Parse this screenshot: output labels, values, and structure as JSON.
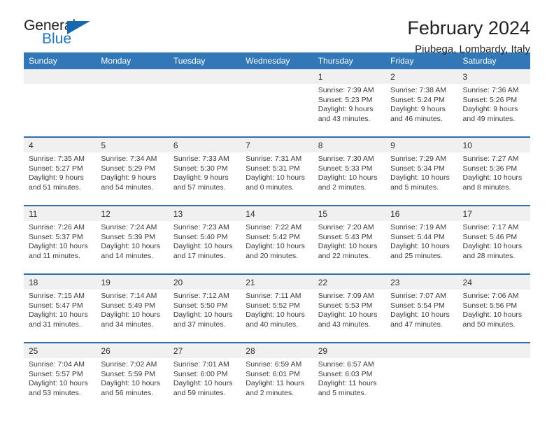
{
  "brand": {
    "name_top": "General",
    "name_bottom": "Blue",
    "triangle_icon": "triangle-icon",
    "colors": {
      "dark": "#222222",
      "blue": "#1a73c4",
      "triangle": "#1569b0"
    }
  },
  "header": {
    "title": "February 2024",
    "subtitle": "Piubega, Lombardy, Italy"
  },
  "colors": {
    "header_bar": "#3277b8",
    "date_band": "#f0f0f0",
    "row_divider": "#2f6fae",
    "text": "#3a3a3a"
  },
  "weekdays": [
    "Sunday",
    "Monday",
    "Tuesday",
    "Wednesday",
    "Thursday",
    "Friday",
    "Saturday"
  ],
  "weeks": [
    {
      "numbers": [
        "",
        "",
        "",
        "",
        "1",
        "2",
        "3"
      ],
      "cells": [
        {
          "sunrise": "",
          "sunset": "",
          "daylight_1": "",
          "daylight_2": ""
        },
        {
          "sunrise": "",
          "sunset": "",
          "daylight_1": "",
          "daylight_2": ""
        },
        {
          "sunrise": "",
          "sunset": "",
          "daylight_1": "",
          "daylight_2": ""
        },
        {
          "sunrise": "",
          "sunset": "",
          "daylight_1": "",
          "daylight_2": ""
        },
        {
          "sunrise": "Sunrise: 7:39 AM",
          "sunset": "Sunset: 5:23 PM",
          "daylight_1": "Daylight: 9 hours",
          "daylight_2": "and 43 minutes."
        },
        {
          "sunrise": "Sunrise: 7:38 AM",
          "sunset": "Sunset: 5:24 PM",
          "daylight_1": "Daylight: 9 hours",
          "daylight_2": "and 46 minutes."
        },
        {
          "sunrise": "Sunrise: 7:36 AM",
          "sunset": "Sunset: 5:26 PM",
          "daylight_1": "Daylight: 9 hours",
          "daylight_2": "and 49 minutes."
        }
      ]
    },
    {
      "numbers": [
        "4",
        "5",
        "6",
        "7",
        "8",
        "9",
        "10"
      ],
      "cells": [
        {
          "sunrise": "Sunrise: 7:35 AM",
          "sunset": "Sunset: 5:27 PM",
          "daylight_1": "Daylight: 9 hours",
          "daylight_2": "and 51 minutes."
        },
        {
          "sunrise": "Sunrise: 7:34 AM",
          "sunset": "Sunset: 5:29 PM",
          "daylight_1": "Daylight: 9 hours",
          "daylight_2": "and 54 minutes."
        },
        {
          "sunrise": "Sunrise: 7:33 AM",
          "sunset": "Sunset: 5:30 PM",
          "daylight_1": "Daylight: 9 hours",
          "daylight_2": "and 57 minutes."
        },
        {
          "sunrise": "Sunrise: 7:31 AM",
          "sunset": "Sunset: 5:31 PM",
          "daylight_1": "Daylight: 10 hours",
          "daylight_2": "and 0 minutes."
        },
        {
          "sunrise": "Sunrise: 7:30 AM",
          "sunset": "Sunset: 5:33 PM",
          "daylight_1": "Daylight: 10 hours",
          "daylight_2": "and 2 minutes."
        },
        {
          "sunrise": "Sunrise: 7:29 AM",
          "sunset": "Sunset: 5:34 PM",
          "daylight_1": "Daylight: 10 hours",
          "daylight_2": "and 5 minutes."
        },
        {
          "sunrise": "Sunrise: 7:27 AM",
          "sunset": "Sunset: 5:36 PM",
          "daylight_1": "Daylight: 10 hours",
          "daylight_2": "and 8 minutes."
        }
      ]
    },
    {
      "numbers": [
        "11",
        "12",
        "13",
        "14",
        "15",
        "16",
        "17"
      ],
      "cells": [
        {
          "sunrise": "Sunrise: 7:26 AM",
          "sunset": "Sunset: 5:37 PM",
          "daylight_1": "Daylight: 10 hours",
          "daylight_2": "and 11 minutes."
        },
        {
          "sunrise": "Sunrise: 7:24 AM",
          "sunset": "Sunset: 5:39 PM",
          "daylight_1": "Daylight: 10 hours",
          "daylight_2": "and 14 minutes."
        },
        {
          "sunrise": "Sunrise: 7:23 AM",
          "sunset": "Sunset: 5:40 PM",
          "daylight_1": "Daylight: 10 hours",
          "daylight_2": "and 17 minutes."
        },
        {
          "sunrise": "Sunrise: 7:22 AM",
          "sunset": "Sunset: 5:42 PM",
          "daylight_1": "Daylight: 10 hours",
          "daylight_2": "and 20 minutes."
        },
        {
          "sunrise": "Sunrise: 7:20 AM",
          "sunset": "Sunset: 5:43 PM",
          "daylight_1": "Daylight: 10 hours",
          "daylight_2": "and 22 minutes."
        },
        {
          "sunrise": "Sunrise: 7:19 AM",
          "sunset": "Sunset: 5:44 PM",
          "daylight_1": "Daylight: 10 hours",
          "daylight_2": "and 25 minutes."
        },
        {
          "sunrise": "Sunrise: 7:17 AM",
          "sunset": "Sunset: 5:46 PM",
          "daylight_1": "Daylight: 10 hours",
          "daylight_2": "and 28 minutes."
        }
      ]
    },
    {
      "numbers": [
        "18",
        "19",
        "20",
        "21",
        "22",
        "23",
        "24"
      ],
      "cells": [
        {
          "sunrise": "Sunrise: 7:15 AM",
          "sunset": "Sunset: 5:47 PM",
          "daylight_1": "Daylight: 10 hours",
          "daylight_2": "and 31 minutes."
        },
        {
          "sunrise": "Sunrise: 7:14 AM",
          "sunset": "Sunset: 5:49 PM",
          "daylight_1": "Daylight: 10 hours",
          "daylight_2": "and 34 minutes."
        },
        {
          "sunrise": "Sunrise: 7:12 AM",
          "sunset": "Sunset: 5:50 PM",
          "daylight_1": "Daylight: 10 hours",
          "daylight_2": "and 37 minutes."
        },
        {
          "sunrise": "Sunrise: 7:11 AM",
          "sunset": "Sunset: 5:52 PM",
          "daylight_1": "Daylight: 10 hours",
          "daylight_2": "and 40 minutes."
        },
        {
          "sunrise": "Sunrise: 7:09 AM",
          "sunset": "Sunset: 5:53 PM",
          "daylight_1": "Daylight: 10 hours",
          "daylight_2": "and 43 minutes."
        },
        {
          "sunrise": "Sunrise: 7:07 AM",
          "sunset": "Sunset: 5:54 PM",
          "daylight_1": "Daylight: 10 hours",
          "daylight_2": "and 47 minutes."
        },
        {
          "sunrise": "Sunrise: 7:06 AM",
          "sunset": "Sunset: 5:56 PM",
          "daylight_1": "Daylight: 10 hours",
          "daylight_2": "and 50 minutes."
        }
      ]
    },
    {
      "numbers": [
        "25",
        "26",
        "27",
        "28",
        "29",
        "",
        ""
      ],
      "cells": [
        {
          "sunrise": "Sunrise: 7:04 AM",
          "sunset": "Sunset: 5:57 PM",
          "daylight_1": "Daylight: 10 hours",
          "daylight_2": "and 53 minutes."
        },
        {
          "sunrise": "Sunrise: 7:02 AM",
          "sunset": "Sunset: 5:59 PM",
          "daylight_1": "Daylight: 10 hours",
          "daylight_2": "and 56 minutes."
        },
        {
          "sunrise": "Sunrise: 7:01 AM",
          "sunset": "Sunset: 6:00 PM",
          "daylight_1": "Daylight: 10 hours",
          "daylight_2": "and 59 minutes."
        },
        {
          "sunrise": "Sunrise: 6:59 AM",
          "sunset": "Sunset: 6:01 PM",
          "daylight_1": "Daylight: 11 hours",
          "daylight_2": "and 2 minutes."
        },
        {
          "sunrise": "Sunrise: 6:57 AM",
          "sunset": "Sunset: 6:03 PM",
          "daylight_1": "Daylight: 11 hours",
          "daylight_2": "and 5 minutes."
        },
        {
          "sunrise": "",
          "sunset": "",
          "daylight_1": "",
          "daylight_2": ""
        },
        {
          "sunrise": "",
          "sunset": "",
          "daylight_1": "",
          "daylight_2": ""
        }
      ]
    }
  ]
}
